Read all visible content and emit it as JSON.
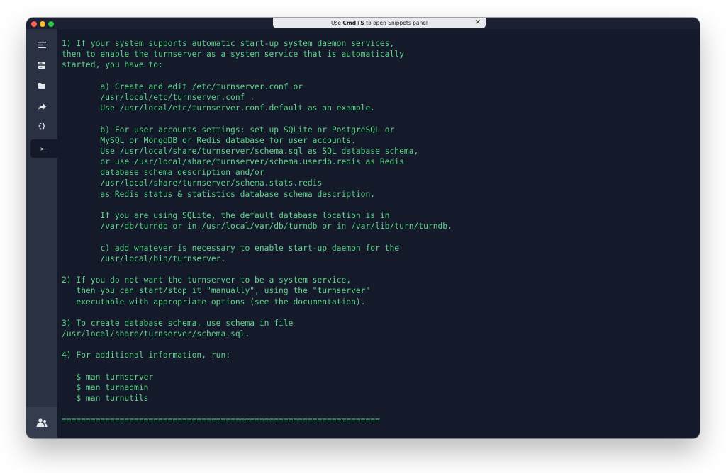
{
  "window": {
    "banner": {
      "prefix": "Use ",
      "shortcut": "Cmd+S",
      "suffix": " to open Snippets panel",
      "close_glyph": "✕"
    }
  },
  "sidebar": {
    "items": [
      {
        "name": "hosts-icon"
      },
      {
        "name": "servers-icon"
      },
      {
        "name": "folder-icon"
      },
      {
        "name": "port-forward-icon"
      },
      {
        "name": "snippets-icon",
        "glyph": "{}"
      },
      {
        "name": "terminal-icon",
        "glyph": ">_",
        "active": true
      }
    ],
    "bottom": {
      "name": "team-icon"
    }
  },
  "terminal": {
    "lines": [
      "1) If your system supports automatic start-up system daemon services,",
      "then to enable the turnserver as a system service that is automatically",
      "started, you have to:",
      "",
      "        a) Create and edit /etc/turnserver.conf or",
      "        /usr/local/etc/turnserver.conf .",
      "        Use /usr/local/etc/turnserver.conf.default as an example.",
      "",
      "        b) For user accounts settings: set up SQLite or PostgreSQL or",
      "        MySQL or MongoDB or Redis database for user accounts.",
      "        Use /usr/local/share/turnserver/schema.sql as SQL database schema,",
      "        or use /usr/local/share/turnserver/schema.userdb.redis as Redis",
      "        database schema description and/or",
      "        /usr/local/share/turnserver/schema.stats.redis",
      "        as Redis status & statistics database schema description.",
      "",
      "        If you are using SQLite, the default database location is in",
      "        /var/db/turndb or in /usr/local/var/db/turndb or in /var/lib/turn/turndb.",
      "",
      "        c) add whatever is necessary to enable start-up daemon for the",
      "        /usr/local/bin/turnserver.",
      "",
      "2) If you do not want the turnserver to be a system service,",
      "   then you can start/stop it \"manually\", using the \"turnserver\"",
      "   executable with appropriate options (see the documentation).",
      "",
      "3) To create database schema, use schema in file",
      "/usr/local/share/turnserver/schema.sql.",
      "",
      "4) For additional information, run:",
      "",
      "   $ man turnserver",
      "   $ man turnadmin",
      "   $ man turnutils",
      "",
      "=================================================================="
    ]
  },
  "colors": {
    "terminal_bg": "#141a2a",
    "terminal_text": "#5fd48a",
    "sidebar_bg": "#2a3142",
    "banner_bg": "#e9eaee"
  }
}
